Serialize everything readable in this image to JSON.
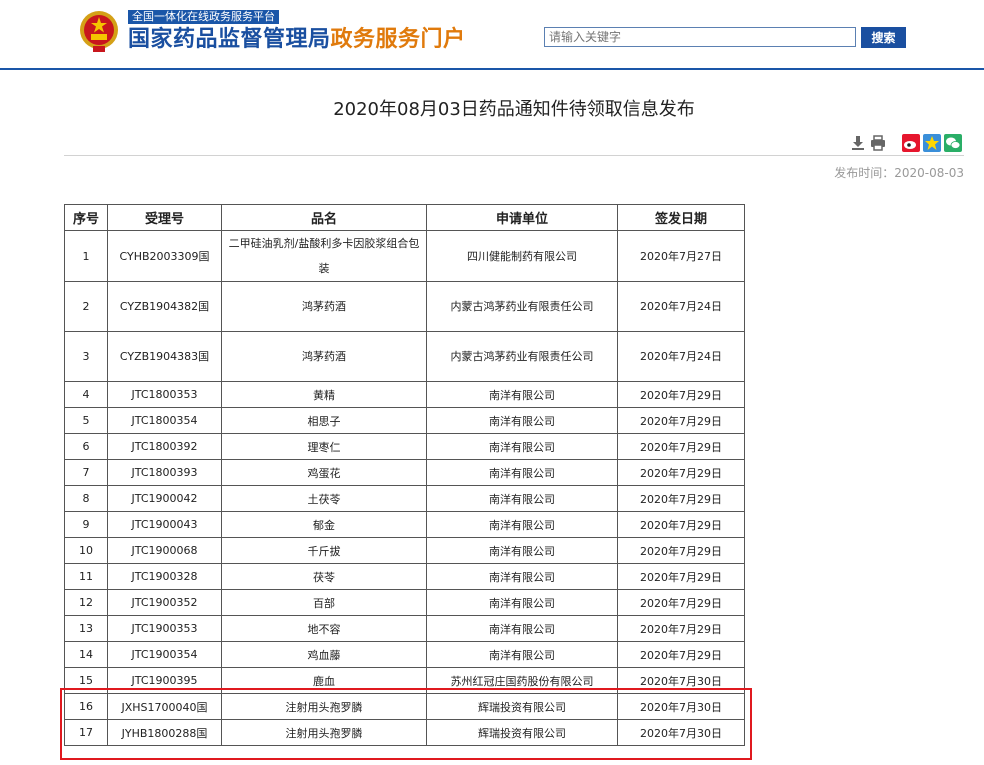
{
  "header": {
    "platform_tag": "全国一体化在线政务服务平台",
    "site_name_primary": "国家药品监督管理局",
    "site_name_secondary": "政务服务门户",
    "search_placeholder": "请输入关键字",
    "search_button": "搜索",
    "colors": {
      "brand_blue": "#1a4fa0",
      "accent_orange": "#e07a0c"
    }
  },
  "article": {
    "title": "2020年08月03日药品通知件待领取信息发布",
    "publish_label": "发布时间：2020-08-03",
    "tools": [
      "download-icon",
      "print-icon",
      "weibo-icon",
      "favorite-icon",
      "wechat-icon"
    ]
  },
  "table": {
    "columns": [
      "序号",
      "受理号",
      "品名",
      "申请单位",
      "签发日期"
    ],
    "rows": [
      {
        "no": "1",
        "acceptance": "CYHB2003309国",
        "name": "二甲硅油乳剂/盐酸利多卡因胶浆组合包装",
        "unit": "四川健能制药有限公司",
        "date": "2020年7月27日",
        "tall": true
      },
      {
        "no": "2",
        "acceptance": "CYZB1904382国",
        "name": "鸿茅药酒",
        "unit": "内蒙古鸿茅药业有限责任公司",
        "date": "2020年7月24日",
        "tall": true
      },
      {
        "no": "3",
        "acceptance": "CYZB1904383国",
        "name": "鸿茅药酒",
        "unit": "内蒙古鸿茅药业有限责任公司",
        "date": "2020年7月24日",
        "tall": true
      },
      {
        "no": "4",
        "acceptance": "JTC1800353",
        "name": "黄精",
        "unit": "南洋有限公司",
        "date": "2020年7月29日"
      },
      {
        "no": "5",
        "acceptance": "JTC1800354",
        "name": "相思子",
        "unit": "南洋有限公司",
        "date": "2020年7月29日"
      },
      {
        "no": "6",
        "acceptance": "JTC1800392",
        "name": "理枣仁",
        "unit": "南洋有限公司",
        "date": "2020年7月29日"
      },
      {
        "no": "7",
        "acceptance": "JTC1800393",
        "name": "鸡蛋花",
        "unit": "南洋有限公司",
        "date": "2020年7月29日"
      },
      {
        "no": "8",
        "acceptance": "JTC1900042",
        "name": "土茯苓",
        "unit": "南洋有限公司",
        "date": "2020年7月29日"
      },
      {
        "no": "9",
        "acceptance": "JTC1900043",
        "name": "郁金",
        "unit": "南洋有限公司",
        "date": "2020年7月29日"
      },
      {
        "no": "10",
        "acceptance": "JTC1900068",
        "name": "千斤拔",
        "unit": "南洋有限公司",
        "date": "2020年7月29日"
      },
      {
        "no": "11",
        "acceptance": "JTC1900328",
        "name": "茯苓",
        "unit": "南洋有限公司",
        "date": "2020年7月29日"
      },
      {
        "no": "12",
        "acceptance": "JTC1900352",
        "name": "百部",
        "unit": "南洋有限公司",
        "date": "2020年7月29日"
      },
      {
        "no": "13",
        "acceptance": "JTC1900353",
        "name": "地不容",
        "unit": "南洋有限公司",
        "date": "2020年7月29日"
      },
      {
        "no": "14",
        "acceptance": "JTC1900354",
        "name": "鸡血藤",
        "unit": "南洋有限公司",
        "date": "2020年7月29日"
      },
      {
        "no": "15",
        "acceptance": "JTC1900395",
        "name": "鹿血",
        "unit": "苏州红冠庄国药股份有限公司",
        "date": "2020年7月30日"
      },
      {
        "no": "16",
        "acceptance": "JXHS1700040国",
        "name": "注射用头孢罗膦",
        "unit": "辉瑞投资有限公司",
        "date": "2020年7月30日"
      },
      {
        "no": "17",
        "acceptance": "JYHB1800288国",
        "name": "注射用头孢罗膦",
        "unit": "辉瑞投资有限公司",
        "date": "2020年7月30日"
      }
    ],
    "highlight_color": "#e0191f"
  }
}
